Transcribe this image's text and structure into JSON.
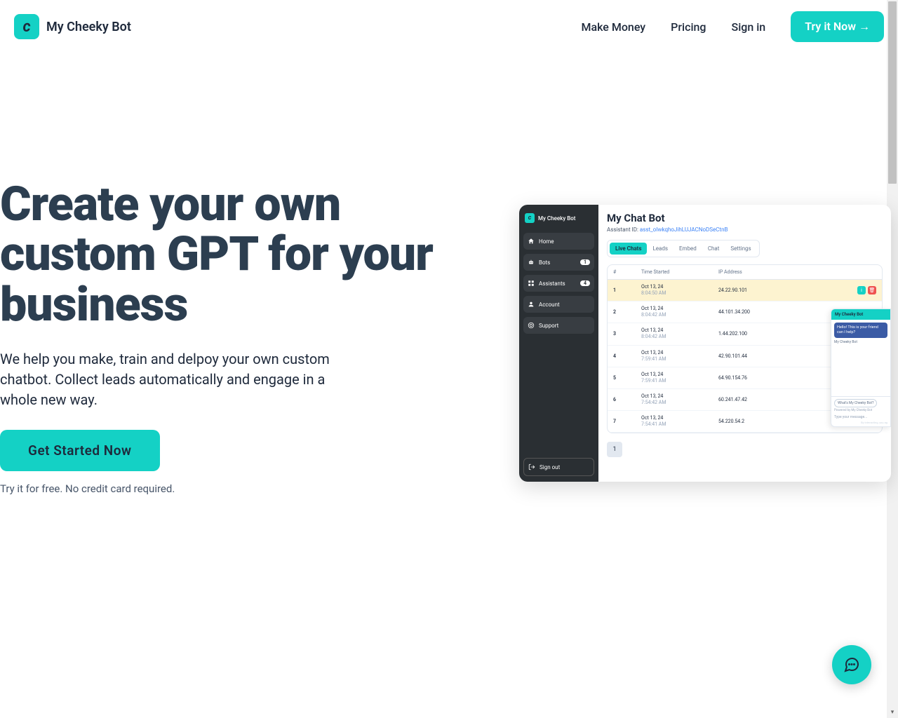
{
  "brand": {
    "name": "My Cheeky Bot",
    "logo_char": "c"
  },
  "nav": {
    "items": [
      {
        "label": "Make Money"
      },
      {
        "label": "Pricing"
      },
      {
        "label": "Sign in"
      }
    ],
    "cta": "Try it Now →"
  },
  "hero": {
    "title": "Create your own custom GPT for your business",
    "subtitle": "We help you make, train and delpoy your own custom chatbot. Collect leads automatically and engage in a whole new way.",
    "button": "Get Started Now",
    "note": "Try it for free. No credit card required."
  },
  "preview": {
    "brand": "My Cheeky Bot",
    "sidebar": {
      "items": [
        {
          "icon": "home",
          "label": "Home"
        },
        {
          "icon": "robot",
          "label": "Bots",
          "badge": "1"
        },
        {
          "icon": "grid",
          "label": "Assistants",
          "badge": "4"
        },
        {
          "icon": "user",
          "label": "Account"
        },
        {
          "icon": "life-ring",
          "label": "Support"
        }
      ],
      "signout": "Sign out"
    },
    "main": {
      "title": "My Chat Bot",
      "assistant_label": "Assistant ID: ",
      "assistant_id": "asst_oIwkqhoJihLUJACNoDSeCtnB",
      "tabs": [
        "Live Chats",
        "Leads",
        "Embed",
        "Chat",
        "Settings"
      ],
      "active_tab": 0,
      "columns": {
        "num": "#",
        "time": "Time Started",
        "ip": "IP Address"
      },
      "rows": [
        {
          "n": "1",
          "d": "Oct 13, 24",
          "t": "8:04:50 AM",
          "ip": "24.22.90.101",
          "hl": true,
          "actions": true
        },
        {
          "n": "2",
          "d": "Oct 13, 24",
          "t": "8:04:42 AM",
          "ip": "44.101.34.200"
        },
        {
          "n": "3",
          "d": "Oct 13, 24",
          "t": "8:04:42 AM",
          "ip": "1.44.202.100"
        },
        {
          "n": "4",
          "d": "Oct 13, 24",
          "t": "7:59:41 AM",
          "ip": "42.90.101.44"
        },
        {
          "n": "5",
          "d": "Oct 13, 24",
          "t": "7:59:41 AM",
          "ip": "64.90.154.76"
        },
        {
          "n": "6",
          "d": "Oct 13, 24",
          "t": "7:54:42 AM",
          "ip": "60.241.47.42"
        },
        {
          "n": "7",
          "d": "Oct 13, 24",
          "t": "7:54:41 AM",
          "ip": "54.220.54.2"
        }
      ],
      "page": "1"
    },
    "chat": {
      "title": "My Cheeky Bot",
      "msg": "Hello! This is your friend can I help?",
      "sub": "My Cheeky Bot",
      "pill": "What's My Cheeky Bot?",
      "powered": "Powered by My Cheeky Bot",
      "placeholder": "Type your message...",
      "terms": "By interacting, you ag"
    }
  },
  "colors": {
    "accent": "#14d1c5",
    "dark": "#2a2f33"
  }
}
